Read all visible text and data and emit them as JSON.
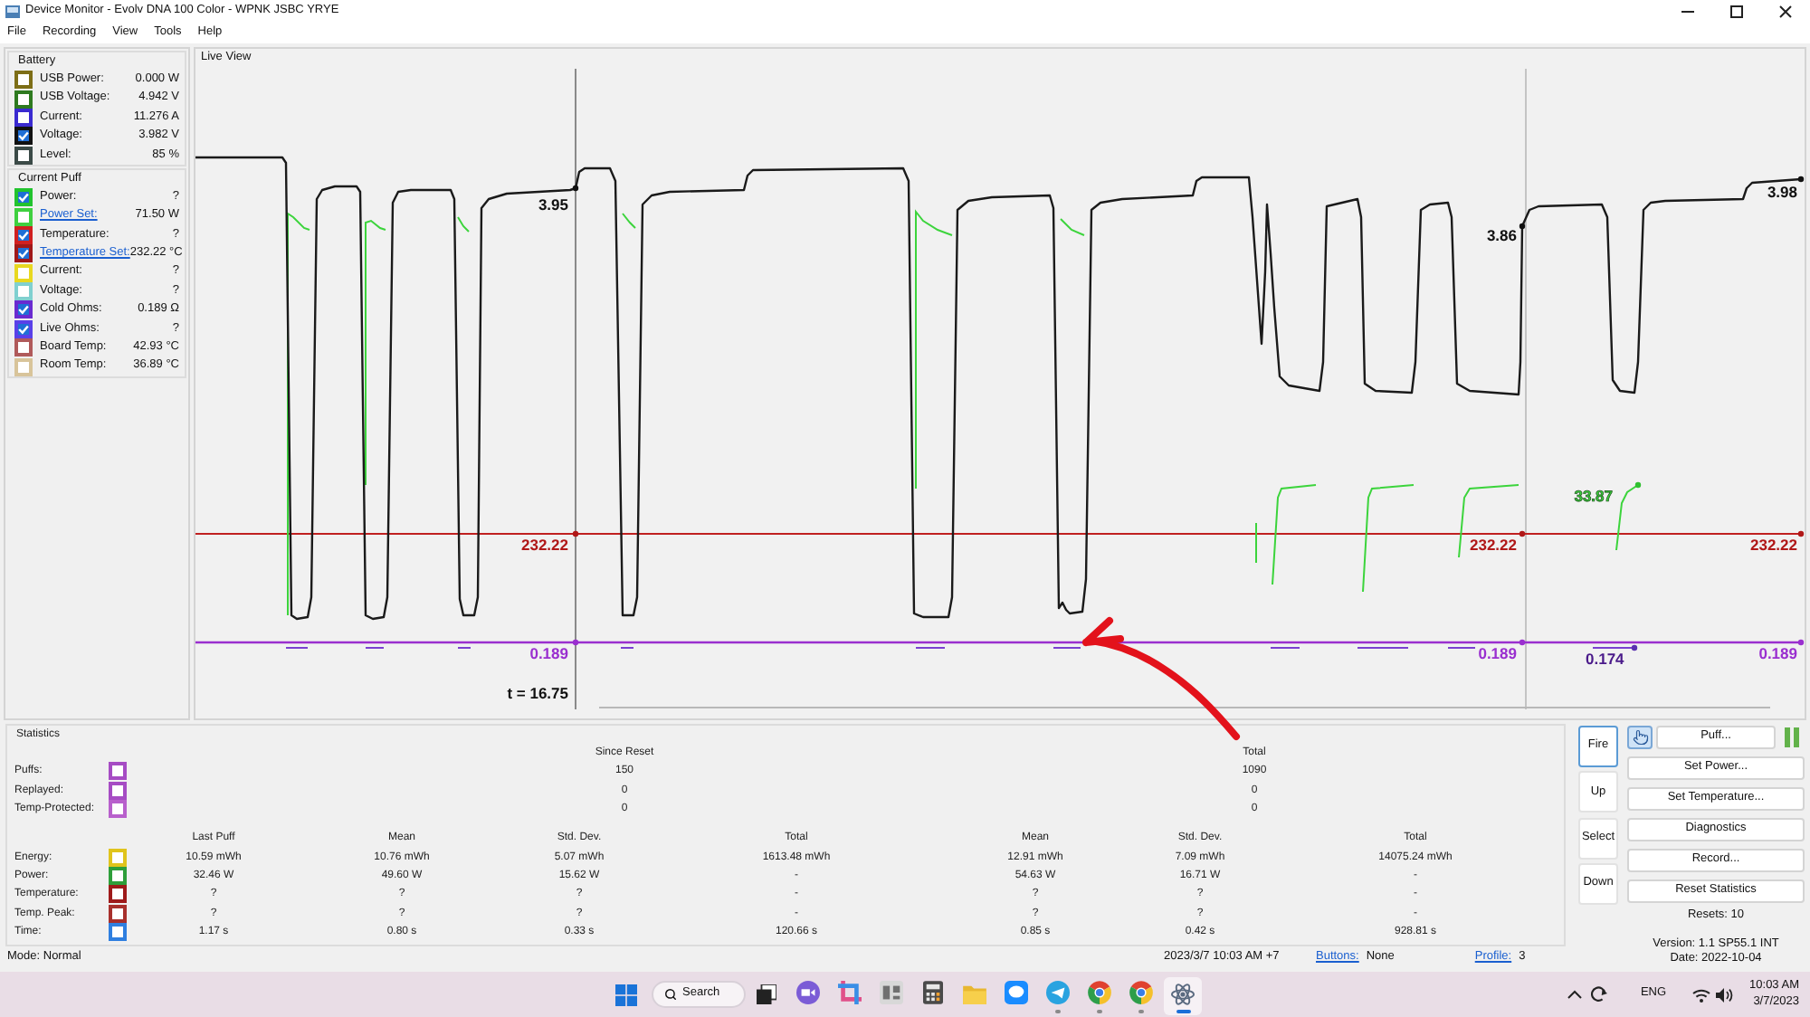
{
  "window": {
    "title": "Device Monitor - Evolv DNA 100 Color - WPNK JSBC YRYE"
  },
  "menu": [
    "File",
    "Recording",
    "View",
    "Tools",
    "Help"
  ],
  "battery": {
    "title": "Battery",
    "items": [
      {
        "label": "USB Power:",
        "value": "0.000 W",
        "color": "#7d6e16",
        "checked": false
      },
      {
        "label": "USB Voltage:",
        "value": "4.942 V",
        "color": "#2e7a1f",
        "checked": false
      },
      {
        "label": "Current:",
        "value": "11.276 A",
        "color": "#3a2ad0",
        "checked": false
      },
      {
        "label": "Voltage:",
        "value": "3.982 V",
        "color": "#111111",
        "checked": true
      },
      {
        "label": "Level:",
        "value": "85 %",
        "color": "#3b4a47",
        "checked": false
      }
    ]
  },
  "current_puff": {
    "title": "Current Puff",
    "items": [
      {
        "label": "Power:",
        "value": "?",
        "color": "#22c32e",
        "checked": true,
        "kind": "label"
      },
      {
        "label": "Power Set:",
        "value": "71.50 W",
        "color": "#3fd03f",
        "checked": false,
        "kind": "link"
      },
      {
        "label": "Temperature:",
        "value": "?",
        "color": "#d02020",
        "checked": true,
        "kind": "label"
      },
      {
        "label": "Temperature Set:",
        "value": "232.22 °C",
        "color": "#a01818",
        "checked": true,
        "kind": "link"
      },
      {
        "label": "Current:",
        "value": "?",
        "color": "#e8d820",
        "checked": false,
        "kind": "label"
      },
      {
        "label": "Voltage:",
        "value": "?",
        "color": "#80d0d0",
        "checked": false,
        "kind": "label"
      },
      {
        "label": "Cold Ohms:",
        "value": "0.189 Ω",
        "color": "#6a2ad0",
        "checked": true,
        "kind": "label"
      },
      {
        "label": "Live Ohms:",
        "value": "?",
        "color": "#5a40e8",
        "checked": true,
        "kind": "label"
      },
      {
        "label": "Board Temp:",
        "value": "42.93 °C",
        "color": "#b05a5a",
        "checked": false,
        "kind": "label"
      },
      {
        "label": "Room Temp:",
        "value": "36.89 °C",
        "color": "#d8c49a",
        "checked": false,
        "kind": "label"
      }
    ]
  },
  "live_view": {
    "title": "Live View",
    "time": "t = 16.75",
    "left_cursor": {
      "voltage": "3.95",
      "temperature_set": "232.22",
      "cold_ohms": "0.189"
    },
    "right_cursor": {
      "voltage": "3.86",
      "temperature_set": "232.22",
      "cold_ohms": "0.189"
    },
    "latest": {
      "power": "33.87",
      "live_ohms": "0.174"
    },
    "right_edge": {
      "voltage": "3.98",
      "temperature_set": "232.22",
      "cold_ohms": "0.189"
    }
  },
  "statistics": {
    "title": "Statistics",
    "count_headers": [
      "Since Reset",
      "Total"
    ],
    "count_rows": [
      {
        "label": "Puffs:",
        "color": "#a64cc4",
        "checked": false,
        "values": [
          "150",
          "1090"
        ]
      },
      {
        "label": "Replayed:",
        "color": "#a64cc4",
        "checked": false,
        "values": [
          "0",
          "0"
        ]
      },
      {
        "label": "Temp-Protected:",
        "color": "#b860cc",
        "checked": false,
        "values": [
          "0",
          "0"
        ]
      }
    ],
    "measure_headers": [
      "Last Puff",
      "Mean",
      "Std. Dev.",
      "Total",
      "Mean",
      "Std. Dev.",
      "Total"
    ],
    "measure_rows": [
      {
        "label": "Energy:",
        "color": "#e0c41c",
        "checked": false,
        "values": [
          "10.59 mWh",
          "10.76 mWh",
          "5.07 mWh",
          "1613.48 mWh",
          "12.91 mWh",
          "7.09 mWh",
          "14075.24 mWh"
        ]
      },
      {
        "label": "Power:",
        "color": "#2e9e3a",
        "checked": false,
        "values": [
          "32.46 W",
          "49.60 W",
          "15.62 W",
          "-",
          "54.63 W",
          "16.71 W",
          "-"
        ]
      },
      {
        "label": "Temperature:",
        "color": "#9e1a1a",
        "checked": false,
        "values": [
          "?",
          "?",
          "?",
          "-",
          "?",
          "?",
          "-"
        ]
      },
      {
        "label": "Temp. Peak:",
        "color": "#a8302c",
        "checked": false,
        "values": [
          "?",
          "?",
          "?",
          "-",
          "?",
          "?",
          "-"
        ]
      },
      {
        "label": "Time:",
        "color": "#2f7fe0",
        "checked": false,
        "values": [
          "1.17 s",
          "0.80 s",
          "0.33 s",
          "120.66 s",
          "0.85 s",
          "0.42 s",
          "928.81 s"
        ]
      }
    ]
  },
  "status_bar": {
    "mode": "Mode: Normal",
    "timestamp": "2023/3/7 10:03 AM +7",
    "buttons_link": "Buttons:",
    "buttons_value": "None",
    "profile_link": "Profile:",
    "profile_value": "3"
  },
  "device_buttons": [
    {
      "label": "Fire",
      "focused": true
    },
    {
      "label": "Up",
      "focused": false
    },
    {
      "label": "Select",
      "focused": false
    },
    {
      "label": "Down",
      "focused": false
    }
  ],
  "puff": {
    "pointer_pressed": true,
    "label": "Puff..."
  },
  "actions": [
    "Set Power...",
    "Set Temperature...",
    "Diagnostics",
    "Record...",
    "Reset Statistics"
  ],
  "resets": "Resets: 10",
  "version": "Version: 1.1 SP55.1 INT",
  "date": "Date: 2022-10-04",
  "taskbar": {
    "search": "Search",
    "apps": [
      {
        "kind": "task-view",
        "running": false,
        "selected": false
      },
      {
        "kind": "video-chat",
        "running": false,
        "selected": false
      },
      {
        "kind": "crop",
        "running": false,
        "selected": false
      },
      {
        "kind": "app",
        "running": false,
        "selected": false
      },
      {
        "kind": "calculator",
        "running": false,
        "selected": false
      },
      {
        "kind": "folder",
        "running": false,
        "selected": false
      },
      {
        "kind": "chat-app",
        "running": false,
        "selected": false
      },
      {
        "kind": "paper-plane",
        "running": true,
        "selected": false
      },
      {
        "kind": "browser",
        "running": true,
        "selected": false
      },
      {
        "kind": "browser",
        "running": true,
        "selected": false
      },
      {
        "kind": "atom",
        "running": true,
        "selected": true
      }
    ],
    "tray": {
      "language": "ENG",
      "time": "10:03 AM",
      "date": "3/7/2023"
    }
  }
}
